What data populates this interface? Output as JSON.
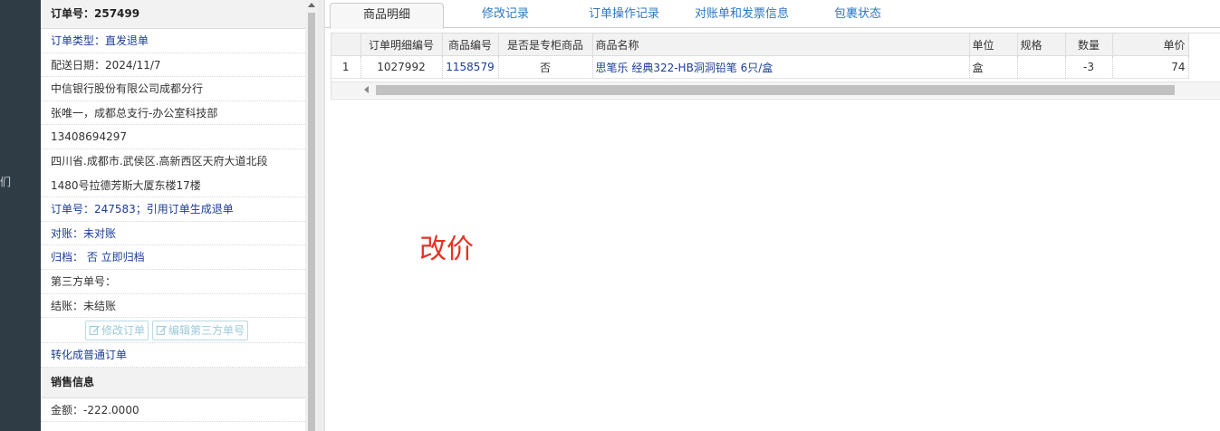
{
  "order_panel": {
    "order_no": "订单号：257499",
    "order_type": "订单类型：直发退单",
    "delivery_date": "配送日期：2024/11/7",
    "company": "中信银行股份有限公司成都分行",
    "contact": "张唯一，成都总支行-办公室科技部",
    "phone": "13408694297",
    "address_line1": "四川省.成都市.武侯区.高新西区天府大道北段",
    "address_line2": "1480号拉德芳斯大厦东楼17楼",
    "ref_order": "订单号：247583；引用订单生成退单",
    "reconcile": "对账：未对账",
    "archive": "归档： 否 立即归档",
    "third_party_no": "第三方单号：",
    "settlement": "结账：未结账",
    "edit_order_btn": "修改订单",
    "edit_third_party_btn": "编辑第三方单号",
    "convert_link": "转化成普通订单",
    "sales_header": "销售信息",
    "amount": "金额：-222.0000"
  },
  "left_nav": {
    "glyph": "们"
  },
  "tabs": [
    "商品明细",
    "修改记录",
    "订单操作记录",
    "对账单和发票信息",
    "包裹状态"
  ],
  "grid": {
    "columns": [
      "",
      "订单明细编号",
      "商品编号",
      "是否是专柜商品",
      "商品名称",
      "单位",
      "规格",
      "数量",
      "单价"
    ],
    "rows": [
      [
        "1",
        "1027992",
        "1158579",
        "否",
        "思笔乐 经典322-HB洞洞铅笔 6只/盒",
        "盒",
        "",
        "-3",
        "74"
      ]
    ]
  },
  "annotation": "改价",
  "colors": {
    "nav_bg": "#2f3b45",
    "link": "#1a3d99",
    "annotation": "#e53323",
    "tab_link": "#2b78c5"
  },
  "icons": [
    "edit-icon",
    "edit-icon"
  ]
}
